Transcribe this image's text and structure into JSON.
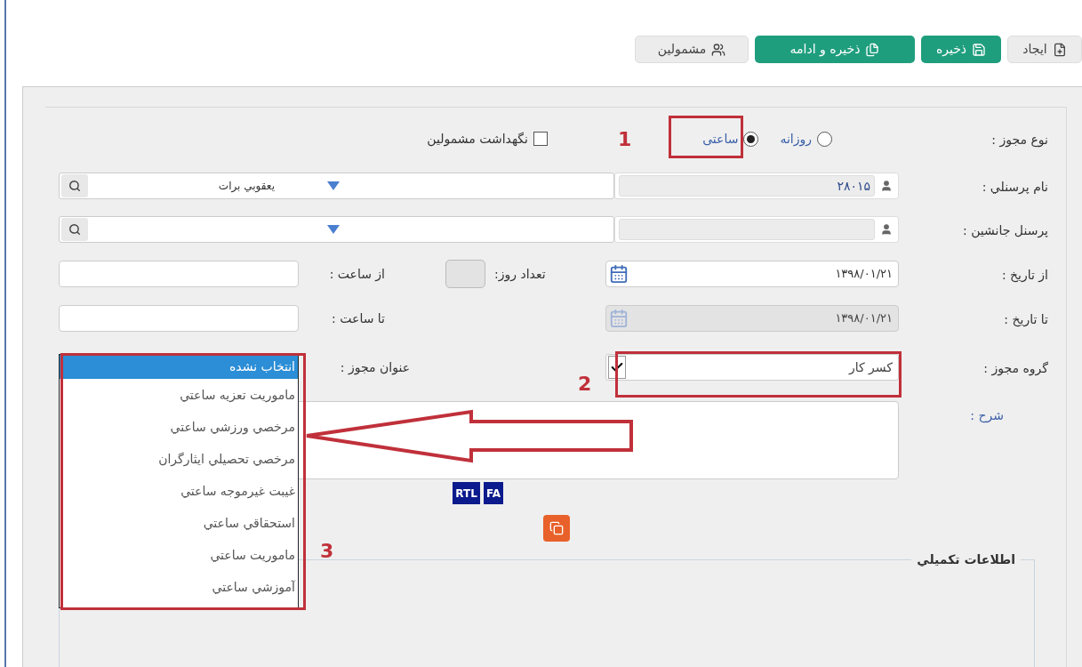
{
  "toolbar": [
    {
      "label": "ایجاد",
      "kind": "plain"
    },
    {
      "label": "ذخیره",
      "kind": "primary"
    },
    {
      "label": "ذخیره و ادامه",
      "kind": "primary"
    },
    {
      "label": "مشمولین",
      "kind": "plain"
    }
  ],
  "permit_type": {
    "label": "نوع مجوز :",
    "options": [
      {
        "label": "روزانه",
        "selected": false
      },
      {
        "label": "ساعتی",
        "selected": true
      }
    ]
  },
  "keep_dependents": {
    "label": "نگهداشت مشمولین",
    "checked": false
  },
  "personnel": {
    "label": "نام پرسنلي :",
    "code": "۲۸۰۱۵",
    "name": "يعقوبي برات"
  },
  "substitute": {
    "label": "پرسنل جانشين :"
  },
  "from_date": {
    "label": "از تاريخ :",
    "value": "۱۳۹۸/۰۱/۲۱",
    "disabled": false
  },
  "to_date": {
    "label": "تا تاريخ :",
    "value": "۱۳۹۸/۰۱/۲۱",
    "disabled": true
  },
  "day_count": {
    "label": "تعداد روز:"
  },
  "from_time": {
    "label": "از ساعت :"
  },
  "to_time": {
    "label": "تا ساعت :"
  },
  "permit_group": {
    "label": "گروه مجوز :",
    "value": "کسر کار"
  },
  "permit_title": {
    "label": "عنوان مجوز :",
    "options": [
      {
        "label": "انتخاب نشده",
        "selected": true
      },
      {
        "label": "ماموريت تعزيه ساعتي",
        "selected": false
      },
      {
        "label": "مرخصي ورزشي ساعتي",
        "selected": false
      },
      {
        "label": "مرخصي تحصيلي ايثارگران",
        "selected": false
      },
      {
        "label": "غيبت غيرموجه ساعتي",
        "selected": false
      },
      {
        "label": "استحقاقي ساعتي",
        "selected": false
      },
      {
        "label": "ماموريت ساعتي",
        "selected": false
      },
      {
        "label": "آموزشي ساعتي",
        "selected": false
      }
    ]
  },
  "description": {
    "label": "شرح :"
  },
  "editor_buttons": [
    "FA",
    "RTL"
  ],
  "extra_info": {
    "legend": "اطلاعات تكميلي"
  },
  "annotations": [
    "1",
    "2",
    "3"
  ]
}
